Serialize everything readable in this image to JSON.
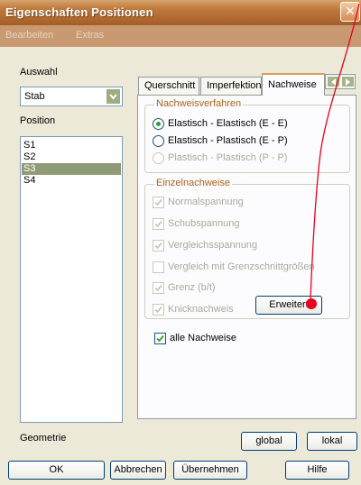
{
  "window": {
    "title": "Eigenschaften Positionen",
    "close_glyph": "✕"
  },
  "menu": [
    {
      "label": "Bearbeiten"
    },
    {
      "label": "Extras"
    }
  ],
  "left": {
    "auswahl_label": "Auswahl",
    "combo_value": "Stab",
    "position_label": "Position",
    "positions": [
      "S1",
      "S2",
      "S3",
      "S4"
    ],
    "selected_index": 2,
    "geometrie_label": "Geometrie"
  },
  "tabs": [
    {
      "label": "Querschnitt",
      "active": false
    },
    {
      "label": "Imperfektion",
      "active": false
    },
    {
      "label": "Nachweise",
      "active": true
    }
  ],
  "nachweisverfahren": {
    "title": "Nachweisverfahren",
    "options": [
      {
        "label": "Elastisch - Elastisch (E - E)",
        "selected": true,
        "enabled": true
      },
      {
        "label": "Elastisch - Plastisch (E - P)",
        "selected": false,
        "enabled": true
      },
      {
        "label": "Plastisch - Plastisch (P - P)",
        "selected": false,
        "enabled": false
      }
    ]
  },
  "einzelnachweise": {
    "title": "Einzelnachweise",
    "items": [
      {
        "label": "Normalspannung",
        "checked": true
      },
      {
        "label": "Schubspannung",
        "checked": true
      },
      {
        "label": "Vergleichsspannung",
        "checked": true
      },
      {
        "label": "Vergleich mit Grenzschnittgrößen",
        "checked": false
      },
      {
        "label": "Grenz (b/t)",
        "checked": true
      },
      {
        "label": "Knicknachweis",
        "checked": true
      }
    ],
    "erweitert_label": "Erweitert"
  },
  "alle_nachweise": {
    "label": "alle Nachweise",
    "checked": true
  },
  "geometry_buttons": {
    "global": "global",
    "lokal": "lokal"
  },
  "footer": {
    "ok": "OK",
    "abbrechen": "Abbrechen",
    "uebernehmen": "Übernehmen",
    "hilfe": "Hilfe"
  },
  "colors": {
    "title_bar": "#b16a30",
    "tab_accent": "#e19a55",
    "group_title": "#b0601a",
    "selection": "#8f9b76",
    "annotation": "#e8001c",
    "check": "#31a131"
  }
}
